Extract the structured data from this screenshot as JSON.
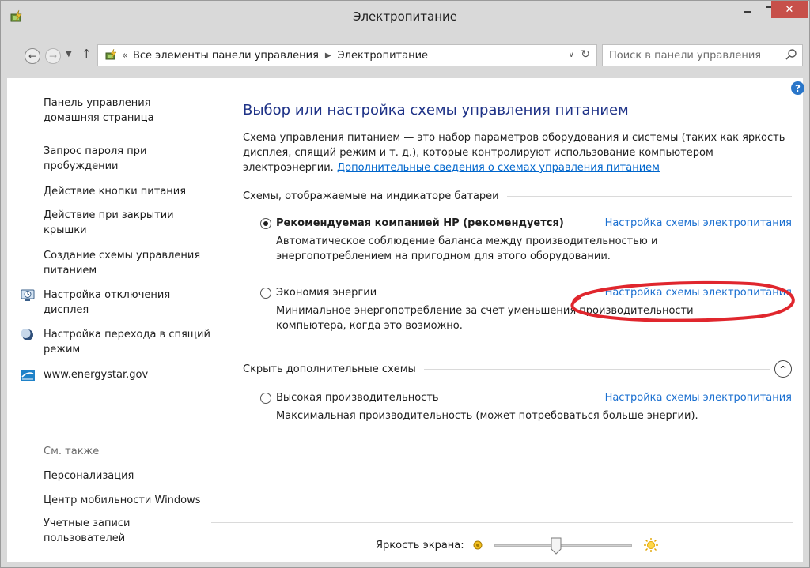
{
  "window": {
    "title": "Электропитание",
    "close_label": "✕"
  },
  "address": {
    "path_prefix": "«",
    "crumbs": [
      "Все элементы панели управления",
      "Электропитание"
    ],
    "search_placeholder": "Поиск в панели управления"
  },
  "sidebar": {
    "items": [
      {
        "label": "Панель управления — домашняя страница"
      },
      {
        "label": "Запрос пароля при пробуждении"
      },
      {
        "label": "Действие кнопки питания"
      },
      {
        "label": "Действие при закрытии крышки"
      },
      {
        "label": "Создание схемы управления питанием"
      },
      {
        "label": "Настройка отключения дисплея",
        "icon": "display-power-icon"
      },
      {
        "label": "Настройка перехода в спящий режим",
        "icon": "sleep-moon-icon"
      },
      {
        "label": "www.energystar.gov",
        "icon": "energystar-icon"
      }
    ],
    "see_also": "См. также",
    "see_also_items": [
      {
        "label": "Персонализация"
      },
      {
        "label": "Центр мобильности Windows"
      },
      {
        "label": "Учетные записи пользователей"
      }
    ]
  },
  "main": {
    "title": "Выбор или настройка схемы управления питанием",
    "desc_text": "Схема управления питанием — это набор параметров оборудования и системы (таких как яркость дисплея, спящий режим и т. д.), которые контролируют использование компьютером электроэнергии. ",
    "desc_link": "Дополнительные сведения о схемах управления питанием",
    "battery_section": "Схемы, отображаемые на индикаторе батареи",
    "hidden_section": "Скрыть дополнительные схемы",
    "plans": [
      {
        "name": "Рекомендуемая компанией HP (рекомендуется)",
        "selected": true,
        "link": "Настройка схемы электропитания",
        "desc": "Автоматическое соблюдение баланса между производительностью и энергопотреблением на пригодном для этого оборудовании."
      },
      {
        "name": "Экономия энергии",
        "selected": false,
        "link": "Настройка схемы электропитания",
        "desc": "Минимальное энергопотребление за счет уменьшения производительности компьютера, когда это возможно."
      },
      {
        "name": "Высокая производительность",
        "selected": false,
        "link": "Настройка схемы электропитания",
        "desc": "Максимальная производительность (может потребоваться больше энергии)."
      }
    ]
  },
  "brightness": {
    "label": "Яркость экрана:",
    "level_percent": 45
  },
  "colors": {
    "accent": "#1e3287",
    "link": "#1a6fd0",
    "close": "#c7504a",
    "annotation": "#e0262d"
  }
}
